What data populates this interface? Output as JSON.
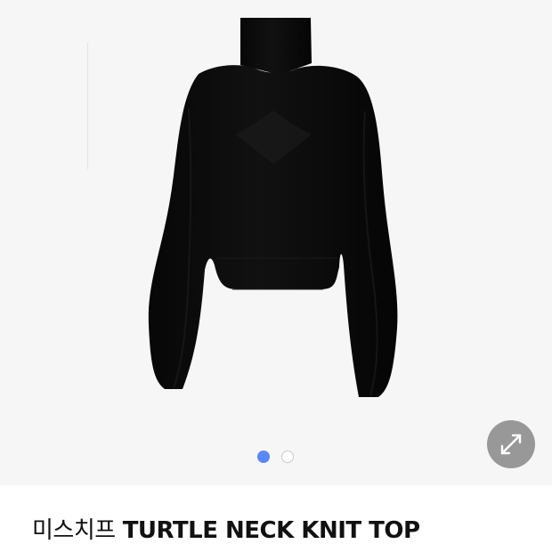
{
  "product": {
    "brand": "미스치프",
    "name": "TURTLE NECK KNIT TOP",
    "image": "black turtle neck knit top"
  },
  "gallery": {
    "pagination_total": 2,
    "pagination_current": 1,
    "expand_icon": "expand-arrows-icon"
  },
  "colors": {
    "active_dot": "#5b88f0",
    "inactive_dot": "#ffffff",
    "expand_button": "#7d7d7d"
  }
}
